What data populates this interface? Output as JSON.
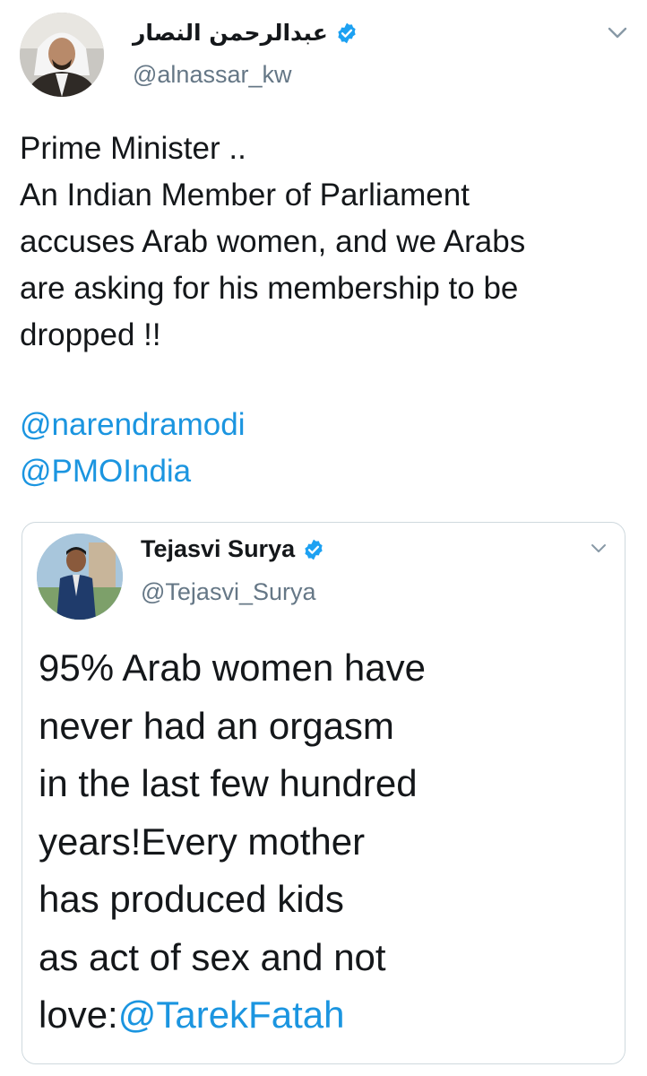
{
  "author": {
    "display_name": "عبدالرحمن النصار",
    "handle": "@alnassar_kw"
  },
  "tweet": {
    "text": "Prime Minister ..\nAn Indian Member of Parliament\naccuses Arab women, and we Arabs\nare asking for his membership to be\ndropped !!",
    "mentions": [
      "@narendramodi",
      "@PMOIndia"
    ]
  },
  "quoted_tweet": {
    "display_name": "Tejasvi Surya",
    "handle": "@Tejasvi_Surya",
    "lines": [
      "95% Arab women have",
      "never had an orgasm",
      "in the last few hundred",
      "years!Every mother",
      "has produced kids",
      "as act of sex and not"
    ],
    "last_line_prefix": "love:",
    "last_line_mention": "@TarekFatah"
  },
  "colors": {
    "link": "#1b95e0",
    "verified": "#1da1f2",
    "secondary_text": "#657786"
  },
  "icons": {
    "verified": "verified-badge-icon",
    "more": "chevron-down-icon"
  }
}
